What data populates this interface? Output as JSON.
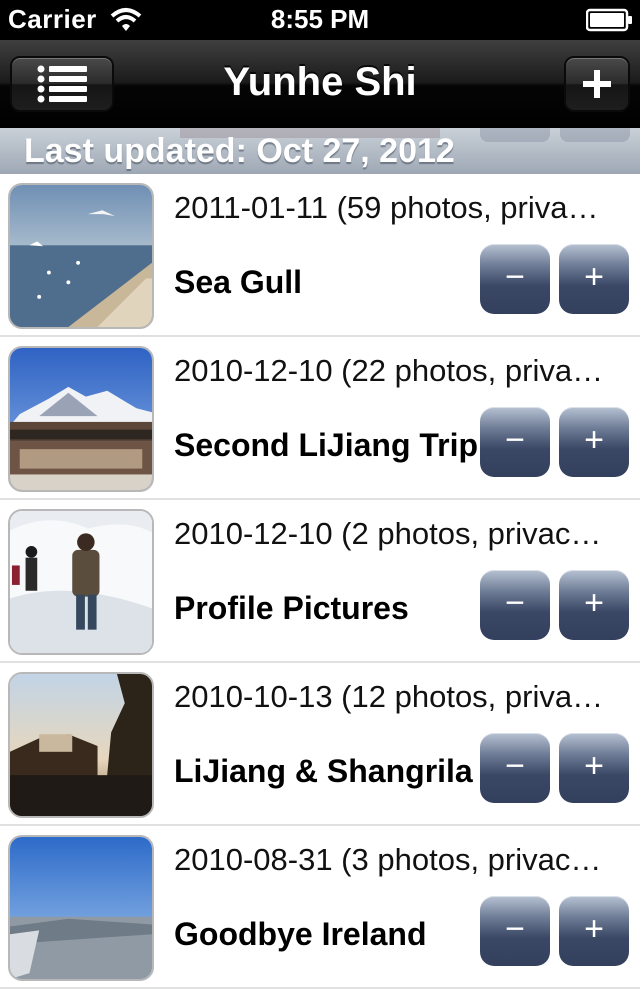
{
  "status_bar": {
    "carrier": "Carrier",
    "time": "8:55 PM"
  },
  "nav": {
    "title": "Yunhe Shi",
    "left_icon": "list-icon",
    "right_icon": "plus-icon"
  },
  "header": {
    "last_updated": "Last updated: Oct 27, 2012"
  },
  "albums": [
    {
      "meta": "2011-01-11 (59 photos, priva…",
      "title": "Sea Gull",
      "minus": "−",
      "plus": "+"
    },
    {
      "meta": "2010-12-10 (22 photos, priva…",
      "title": "Second LiJiang Trip",
      "minus": "−",
      "plus": "+"
    },
    {
      "meta": "2010-12-10 (2 photos, privac…",
      "title": "Profile Pictures",
      "minus": "−",
      "plus": "+"
    },
    {
      "meta": "2010-10-13 (12 photos, priva…",
      "title": "LiJiang & Shangrila",
      "minus": "−",
      "plus": "+"
    },
    {
      "meta": "2010-08-31 (3 photos, privac…",
      "title": "Goodbye Ireland",
      "minus": "−",
      "plus": "+"
    }
  ],
  "colors": {
    "nav_bar": "#1b1b1b",
    "header_bar": "#9ea8b4",
    "row_button": "#3a4765"
  }
}
